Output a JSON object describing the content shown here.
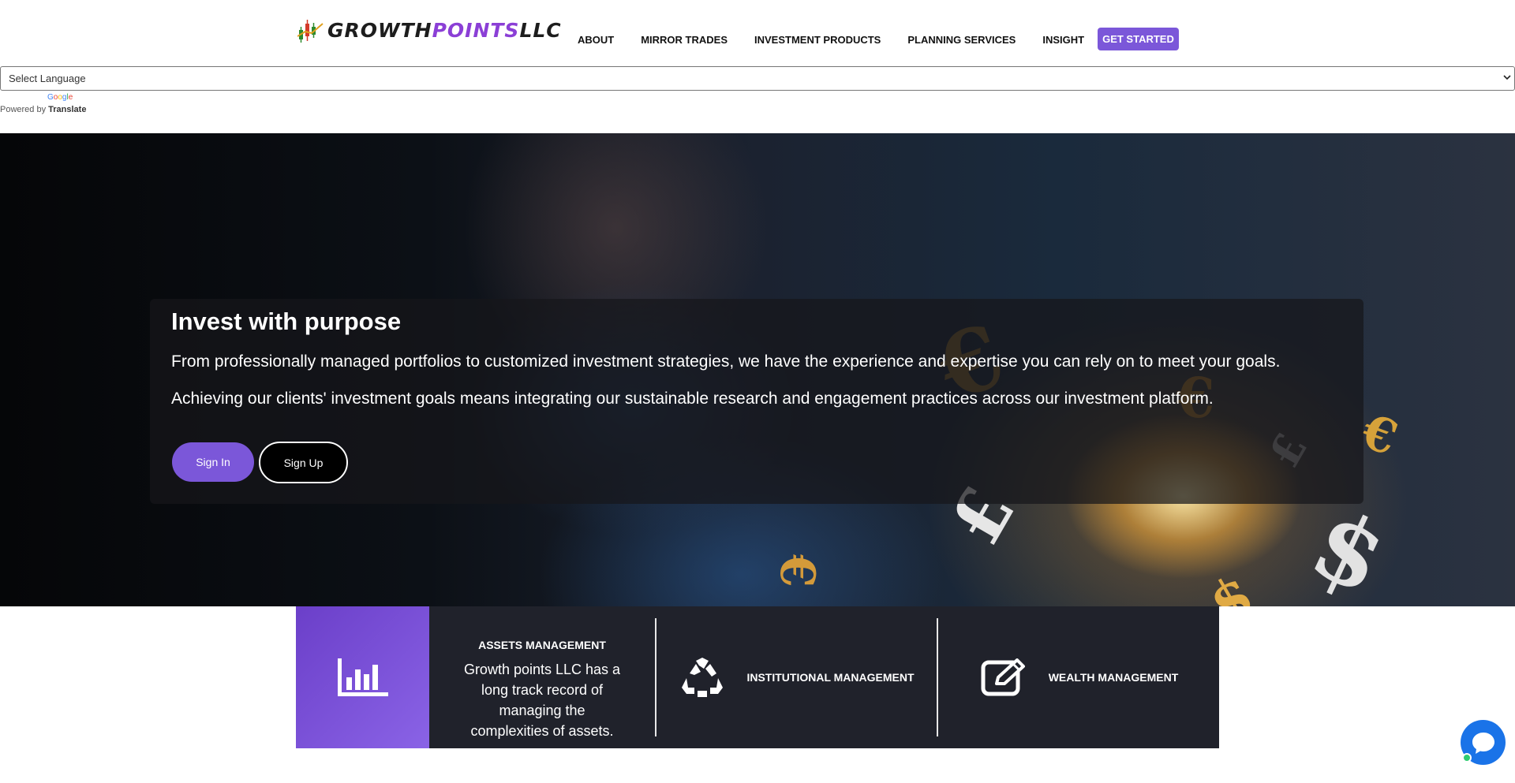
{
  "brand": {
    "name_part1": "GROWTH",
    "name_part2": "POINTS",
    "name_part3": "LLC"
  },
  "nav": {
    "items": [
      "ABOUT",
      "MIRROR TRADES",
      "INVESTMENT PRODUCTS",
      "PLANNING SERVICES",
      "INSIGHT"
    ],
    "cta_label": "GET STARTED"
  },
  "translate": {
    "select_value": "Select Language",
    "google_label": "Google",
    "powered_by": "Powered by",
    "translate_label": "Translate"
  },
  "hero": {
    "title": "Invest with purpose",
    "paragraph1": "From professionally managed portfolios to customized investment strategies, we have the experience and expertise you can rely on to meet your goals.",
    "paragraph2": "Achieving our clients' investment goals means integrating our sustainable research and engagement practices across our investment platform.",
    "sign_in_label": "Sign In",
    "sign_up_label": "Sign Up"
  },
  "features": {
    "assets": {
      "title": "ASSETS MANAGEMENT",
      "description": "Growth points LLC has a long track record of managing the complexities of assets.",
      "icon": "bar-chart-icon"
    },
    "institutional": {
      "title": "INSTITUTIONAL MANAGEMENT",
      "icon": "recycle-icon"
    },
    "wealth": {
      "title": "WEALTH MANAGEMENT",
      "icon": "edit-icon"
    }
  },
  "chat": {
    "icon": "chat-bubble-icon",
    "status_color": "#2ecc71"
  },
  "colors": {
    "accent": "#7b57d9",
    "dark_panel": "#20222b",
    "chat_blue": "#1a73e8"
  }
}
